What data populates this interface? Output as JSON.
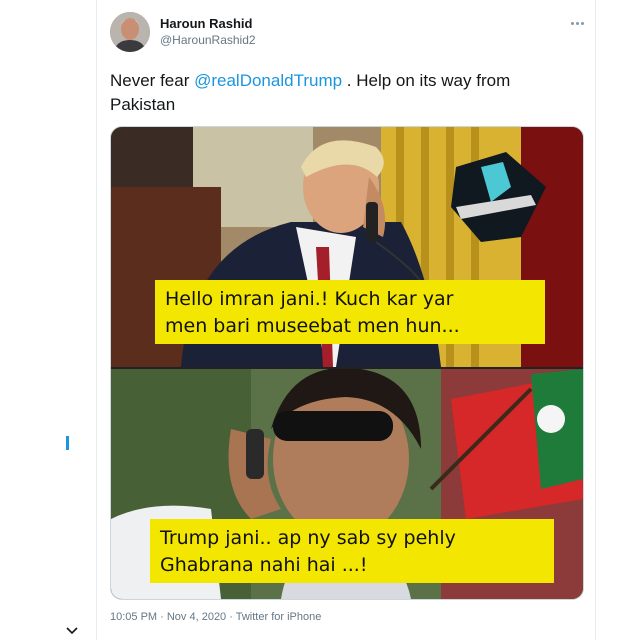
{
  "tweet": {
    "author": {
      "display_name": "Haroun Rashid",
      "handle": "@HarounRashid2"
    },
    "text_prefix": "Never fear ",
    "mention": "@realDonaldTrump",
    "text_suffix": " . Help on its way from Pakistan",
    "media": {
      "caption_top_line1": "Hello imran jani.! Kuch kar yar",
      "caption_top_line2": "men bari museebat men hun...",
      "caption_bottom_line1": "Trump jani.. ap ny sab sy pehly",
      "caption_bottom_line2": "Ghabrana nahi hai ...!"
    },
    "meta": "10:05 PM · Nov 4, 2020 · Twitter for iPhone"
  },
  "colors": {
    "mention": "#1b95e0",
    "caption_bg": "#f3e600",
    "secondary_text": "#657786"
  },
  "icons": {
    "more": "more-icon",
    "chevron": "chevron-down-icon"
  }
}
